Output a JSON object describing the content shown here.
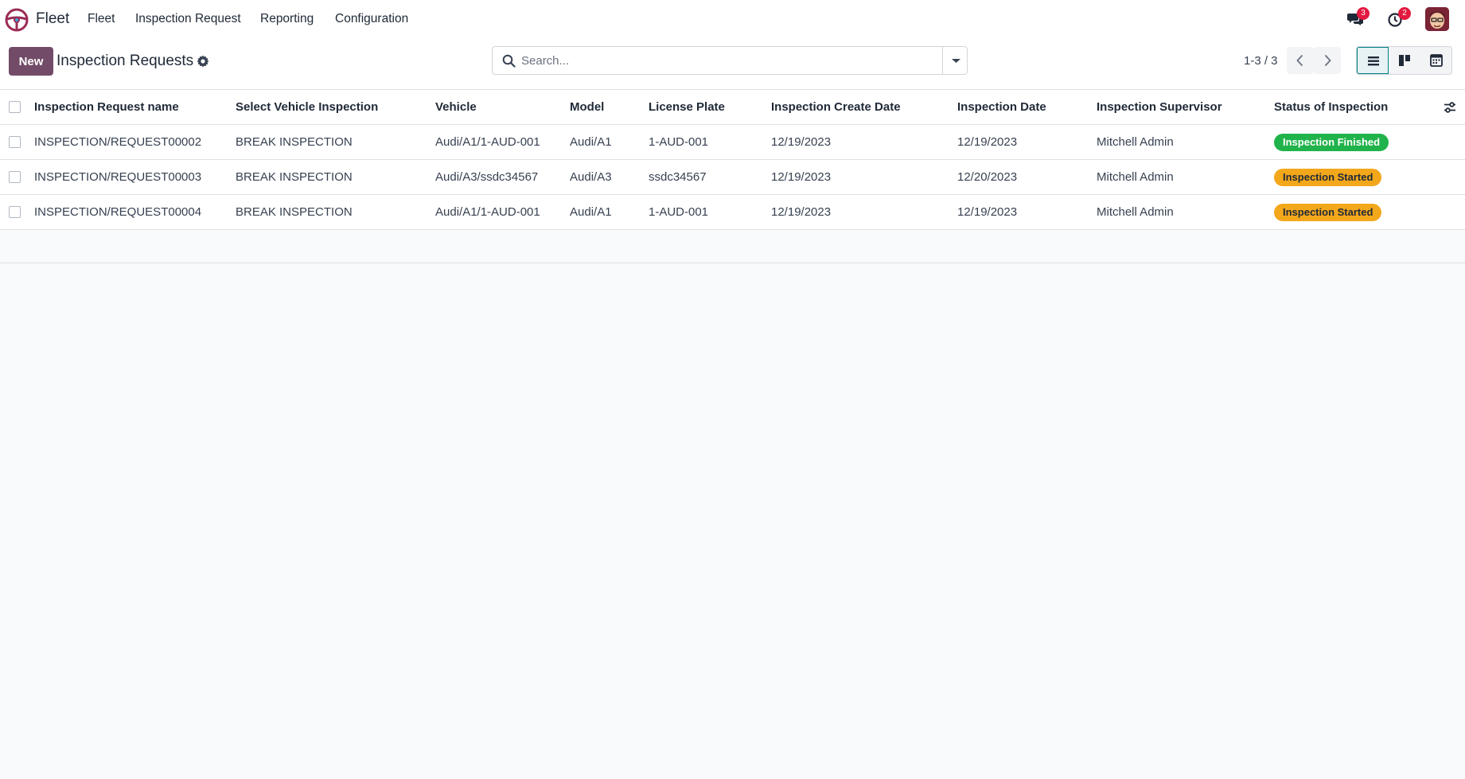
{
  "app": {
    "name": "Fleet"
  },
  "nav": {
    "items": [
      {
        "label": "Fleet"
      },
      {
        "label": "Inspection Request"
      },
      {
        "label": "Reporting"
      },
      {
        "label": "Configuration"
      }
    ]
  },
  "systray": {
    "messages_count": "3",
    "activities_count": "2"
  },
  "control_panel": {
    "new_label": "New",
    "title": "Inspection Requests",
    "search_placeholder": "Search...",
    "pager": "1-3 / 3"
  },
  "list": {
    "columns": [
      "Inspection Request name",
      "Select Vehicle Inspection",
      "Vehicle",
      "Model",
      "License Plate",
      "Inspection Create Date",
      "Inspection Date",
      "Inspection Supervisor",
      "Status of Inspection"
    ],
    "rows": [
      {
        "name": "INSPECTION/REQUEST00002",
        "inspection": "BREAK INSPECTION",
        "vehicle": "Audi/A1/1-AUD-001",
        "model": "Audi/A1",
        "plate": "1-AUD-001",
        "create_date": "12/19/2023",
        "inspection_date": "12/19/2023",
        "supervisor": "Mitchell Admin",
        "status": "Inspection Finished",
        "status_color": "#21b34b"
      },
      {
        "name": "INSPECTION/REQUEST00003",
        "inspection": "BREAK INSPECTION",
        "vehicle": "Audi/A3/ssdc34567",
        "model": "Audi/A3",
        "plate": "ssdc34567",
        "create_date": "12/19/2023",
        "inspection_date": "12/20/2023",
        "supervisor": "Mitchell Admin",
        "status": "Inspection Started",
        "status_color": "#f3a71b"
      },
      {
        "name": "INSPECTION/REQUEST00004",
        "inspection": "BREAK INSPECTION",
        "vehicle": "Audi/A1/1-AUD-001",
        "model": "Audi/A1",
        "plate": "1-AUD-001",
        "create_date": "12/19/2023",
        "inspection_date": "12/19/2023",
        "supervisor": "Mitchell Admin",
        "status": "Inspection Started",
        "status_color": "#f3a71b"
      }
    ]
  },
  "colors": {
    "brand": "#714b67",
    "accent": "#017e84",
    "badge": "#e3193f"
  }
}
